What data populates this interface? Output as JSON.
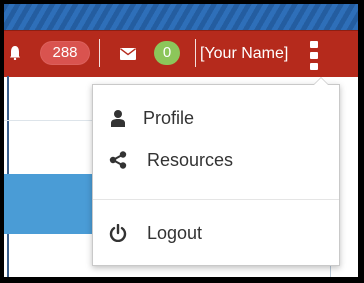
{
  "header": {
    "notifications_count": "288",
    "messages_count": "0",
    "user_name": "[Your Name]"
  },
  "icons": {
    "notifications": "bell-icon",
    "messages": "envelope-icon",
    "menu": "kebab-icon",
    "profile": "user-icon",
    "resources": "share-icon",
    "logout": "power-icon"
  },
  "colors": {
    "topbar": "#b52a1c",
    "stripe": "#2e6fb9",
    "notify_badge": "#d9534f",
    "message_badge": "#8cc65a",
    "content_block": "#4a9cd6"
  },
  "user_menu": {
    "items": [
      {
        "label": "Profile"
      },
      {
        "label": "Resources"
      },
      {
        "label": "Logout"
      }
    ]
  }
}
